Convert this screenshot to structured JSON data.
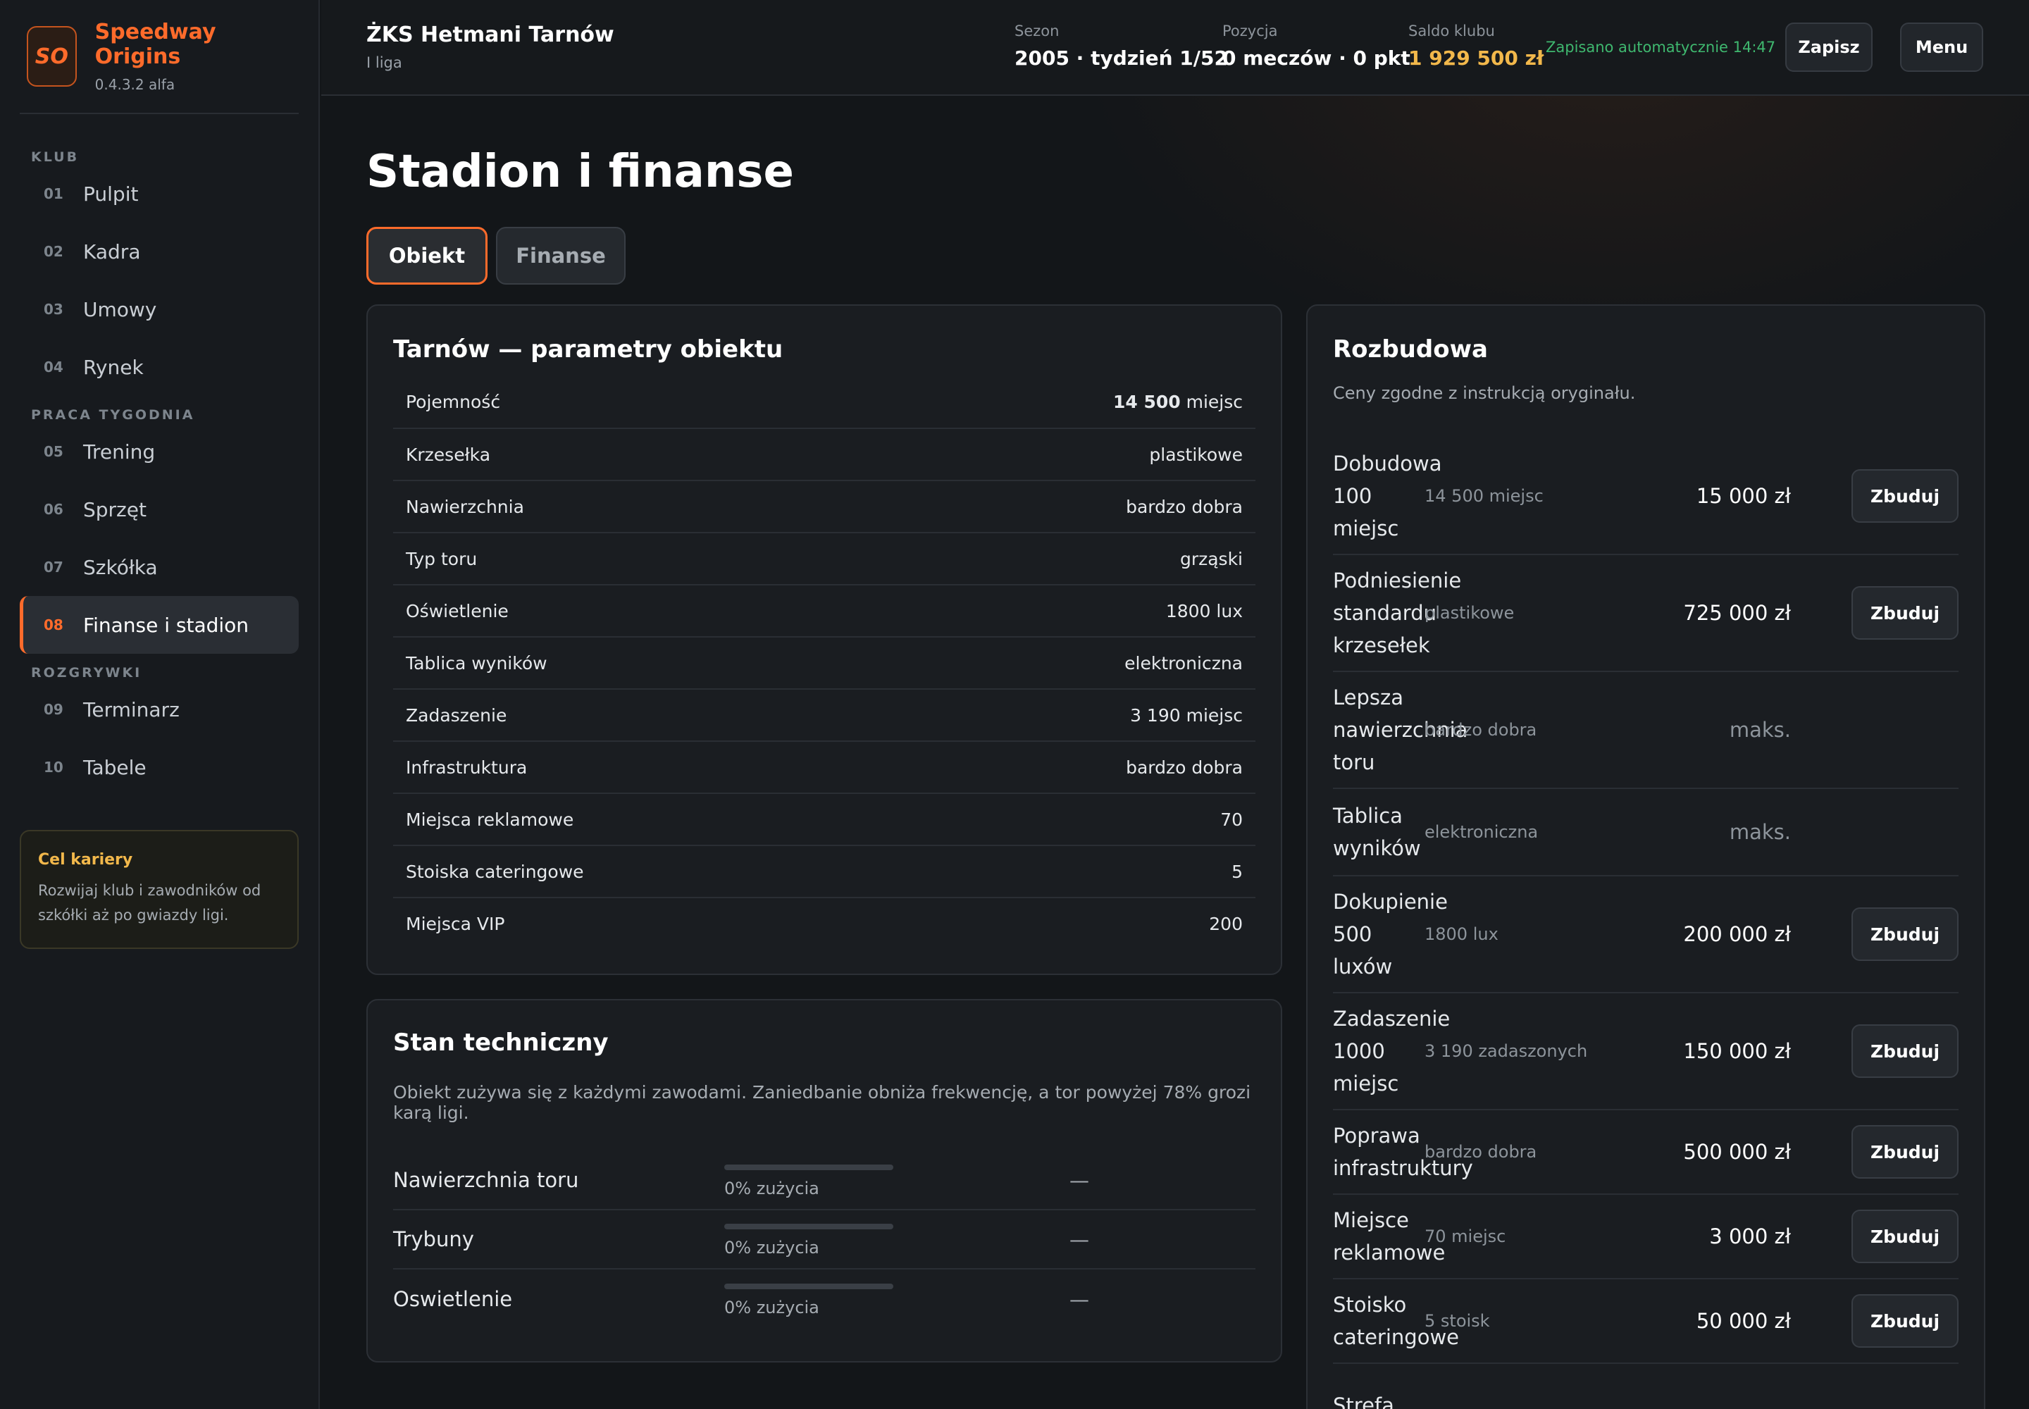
{
  "brand": {
    "logo": "SO",
    "name": "Speedway Origins",
    "version": "0.4.3.2 alfa"
  },
  "sidebar": {
    "sections": [
      {
        "label": "KLUB",
        "items": [
          {
            "num": "01",
            "label": "Pulpit"
          },
          {
            "num": "02",
            "label": "Kadra"
          },
          {
            "num": "03",
            "label": "Umowy"
          },
          {
            "num": "04",
            "label": "Rynek"
          }
        ]
      },
      {
        "label": "PRACA TYGODNIA",
        "items": [
          {
            "num": "05",
            "label": "Trening"
          },
          {
            "num": "06",
            "label": "Sprzęt"
          },
          {
            "num": "07",
            "label": "Szkółka"
          },
          {
            "num": "08",
            "label": "Finanse i stadion",
            "active": true
          }
        ]
      },
      {
        "label": "ROZGRYWKI",
        "items": [
          {
            "num": "09",
            "label": "Terminarz"
          },
          {
            "num": "10",
            "label": "Tabele"
          }
        ]
      }
    ],
    "career": {
      "title": "Cel kariery",
      "text": "Rozwijaj klub i zawodników od szkółki aż po gwiazdy ligi."
    }
  },
  "header": {
    "club_name": "ŻKS Hetmani Tarnów",
    "league": "I liga",
    "season_label": "Sezon",
    "season_value": "2005 · tydzień 1/52",
    "position_label": "Pozycja",
    "position_value": "0 meczów · 0 pkt",
    "balance_label": "Saldo klubu",
    "balance_value": "1 929 500 zł",
    "autosave": "Zapisano automatycznie 14:47",
    "save_button": "Zapisz",
    "menu_button": "Menu"
  },
  "main": {
    "title": "Stadion i finanse",
    "tabs": [
      {
        "label": "Obiekt",
        "active": true
      },
      {
        "label": "Finanse",
        "active": false
      }
    ],
    "params": {
      "title": "Tarnów — parametry obiektu",
      "rows": [
        {
          "label": "Pojemność",
          "value_bold": "14 500",
          "value": " miejsc"
        },
        {
          "label": "Krzesełka",
          "value": "plastikowe"
        },
        {
          "label": "Nawierzchnia",
          "value": "bardzo dobra"
        },
        {
          "label": "Typ toru",
          "value": "grząski"
        },
        {
          "label": "Oświetlenie",
          "value": "1800 lux"
        },
        {
          "label": "Tablica wyników",
          "value": "elektroniczna"
        },
        {
          "label": "Zadaszenie",
          "value": "3 190 miejsc"
        },
        {
          "label": "Infrastruktura",
          "value": "bardzo dobra"
        },
        {
          "label": "Miejsca reklamowe",
          "value": "70"
        },
        {
          "label": "Stoiska cateringowe",
          "value": "5"
        },
        {
          "label": "Miejsca VIP",
          "value": "200"
        }
      ]
    },
    "tech": {
      "title": "Stan techniczny",
      "description": "Obiekt zużywa się z każdymi zawodami. Zaniedbanie obniża frekwencję, a tor powyżej 78% grozi karą ligi.",
      "rows": [
        {
          "name": "Nawierzchnia toru",
          "wear": 0,
          "wear_label": "0% zużycia",
          "action": "—"
        },
        {
          "name": "Trybuny",
          "wear": 0,
          "wear_label": "0% zużycia",
          "action": "—"
        },
        {
          "name": "Oswietlenie",
          "wear": 0,
          "wear_label": "0% zużycia",
          "action": "—"
        }
      ]
    },
    "expansion": {
      "title": "Rozbudowa",
      "description": "Ceny zgodne z instrukcją oryginału.",
      "build_label": "Zbuduj",
      "rows": [
        {
          "name": "Dobudowa 100 miejsc",
          "current": "14 500 miejsc",
          "price": "15 000 zł",
          "buildable": true
        },
        {
          "name": "Podniesienie standardu krzesełek",
          "current": "plastikowe",
          "price": "725 000 zł",
          "buildable": true
        },
        {
          "name": "Lepsza nawierzchnia toru",
          "current": "bardzo dobra",
          "price": "maks.",
          "buildable": false
        },
        {
          "name": "Tablica wyników",
          "current": "elektroniczna",
          "price": "maks.",
          "buildable": false
        },
        {
          "name": "Dokupienie 500 luxów",
          "current": "1800 lux",
          "price": "200 000 zł",
          "buildable": true
        },
        {
          "name": "Zadaszenie 1000 miejsc",
          "current": "3 190 zadaszonych",
          "price": "150 000 zł",
          "buildable": true
        },
        {
          "name": "Poprawa infrastruktury",
          "current": "bardzo dobra",
          "price": "500 000 zł",
          "buildable": true
        },
        {
          "name": "Miejsce reklamowe",
          "current": "70 miejsc",
          "price": "3 000 zł",
          "buildable": true
        },
        {
          "name": "Stoisko cateringowe",
          "current": "5 stoisk",
          "price": "50 000 zł",
          "buildable": true
        },
        {
          "name": "Strefa",
          "current": "",
          "price": "",
          "buildable": false
        }
      ]
    }
  },
  "colors": {
    "accent": "#ff6b2b",
    "gold": "#f2b84b",
    "success": "#3fb86f",
    "background": "#131619"
  }
}
